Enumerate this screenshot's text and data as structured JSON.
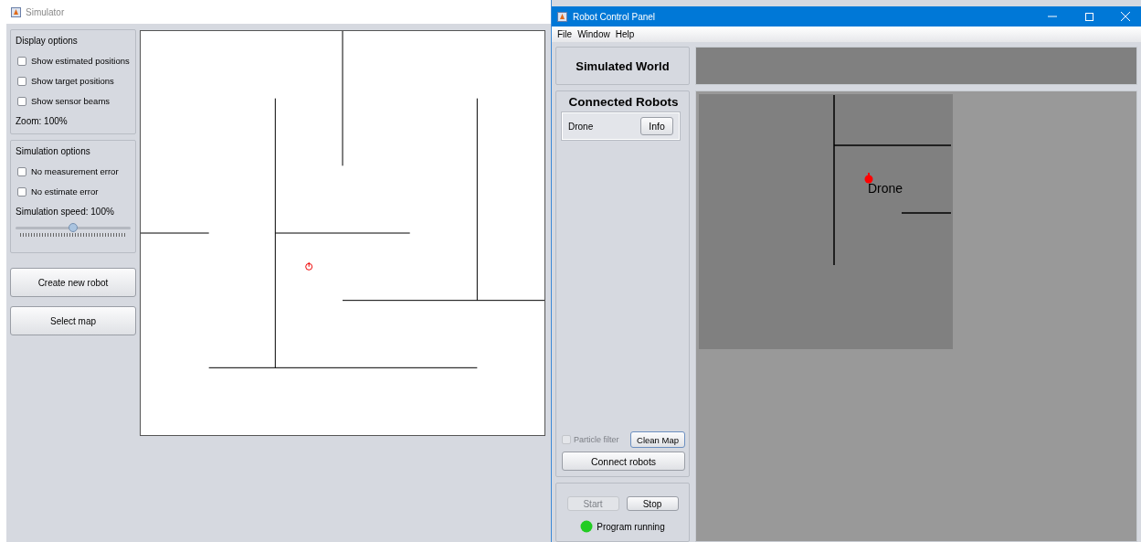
{
  "simulator": {
    "title": "Simulator",
    "display_options": {
      "title": "Display options",
      "checkboxes": [
        {
          "label": "Show estimated positions",
          "checked": false
        },
        {
          "label": "Show target positions",
          "checked": false
        },
        {
          "label": "Show sensor beams",
          "checked": false
        }
      ],
      "zoom": "Zoom:  100%"
    },
    "simulation_options": {
      "title": "Simulation options",
      "checkboxes": [
        {
          "label": "No measurement error",
          "checked": false
        },
        {
          "label": "No estimate error",
          "checked": false
        }
      ],
      "speed": "Simulation speed:  100%",
      "speed_slider": {
        "level": 0.5
      }
    },
    "buttons": [
      "Create new robot",
      "Select map"
    ]
  },
  "control_panel": {
    "title": "Robot Control Panel",
    "menu": [
      "File",
      "Window",
      "Help"
    ],
    "world_title": "Simulated World",
    "robots_title": "Connected Robots",
    "robots": [
      {
        "name": "Drone",
        "button": "Info"
      }
    ],
    "particle_filter": {
      "label": "Particle filter",
      "checked": false,
      "disabled": true
    },
    "clean_map": "Clean Map",
    "connect": "Connect robots",
    "start": {
      "label": "Start",
      "disabled": true
    },
    "stop": {
      "label": "Stop",
      "disabled": false
    },
    "status": {
      "label": "Program running",
      "running": true
    },
    "map_view": {
      "robot_label": "Drone"
    }
  }
}
